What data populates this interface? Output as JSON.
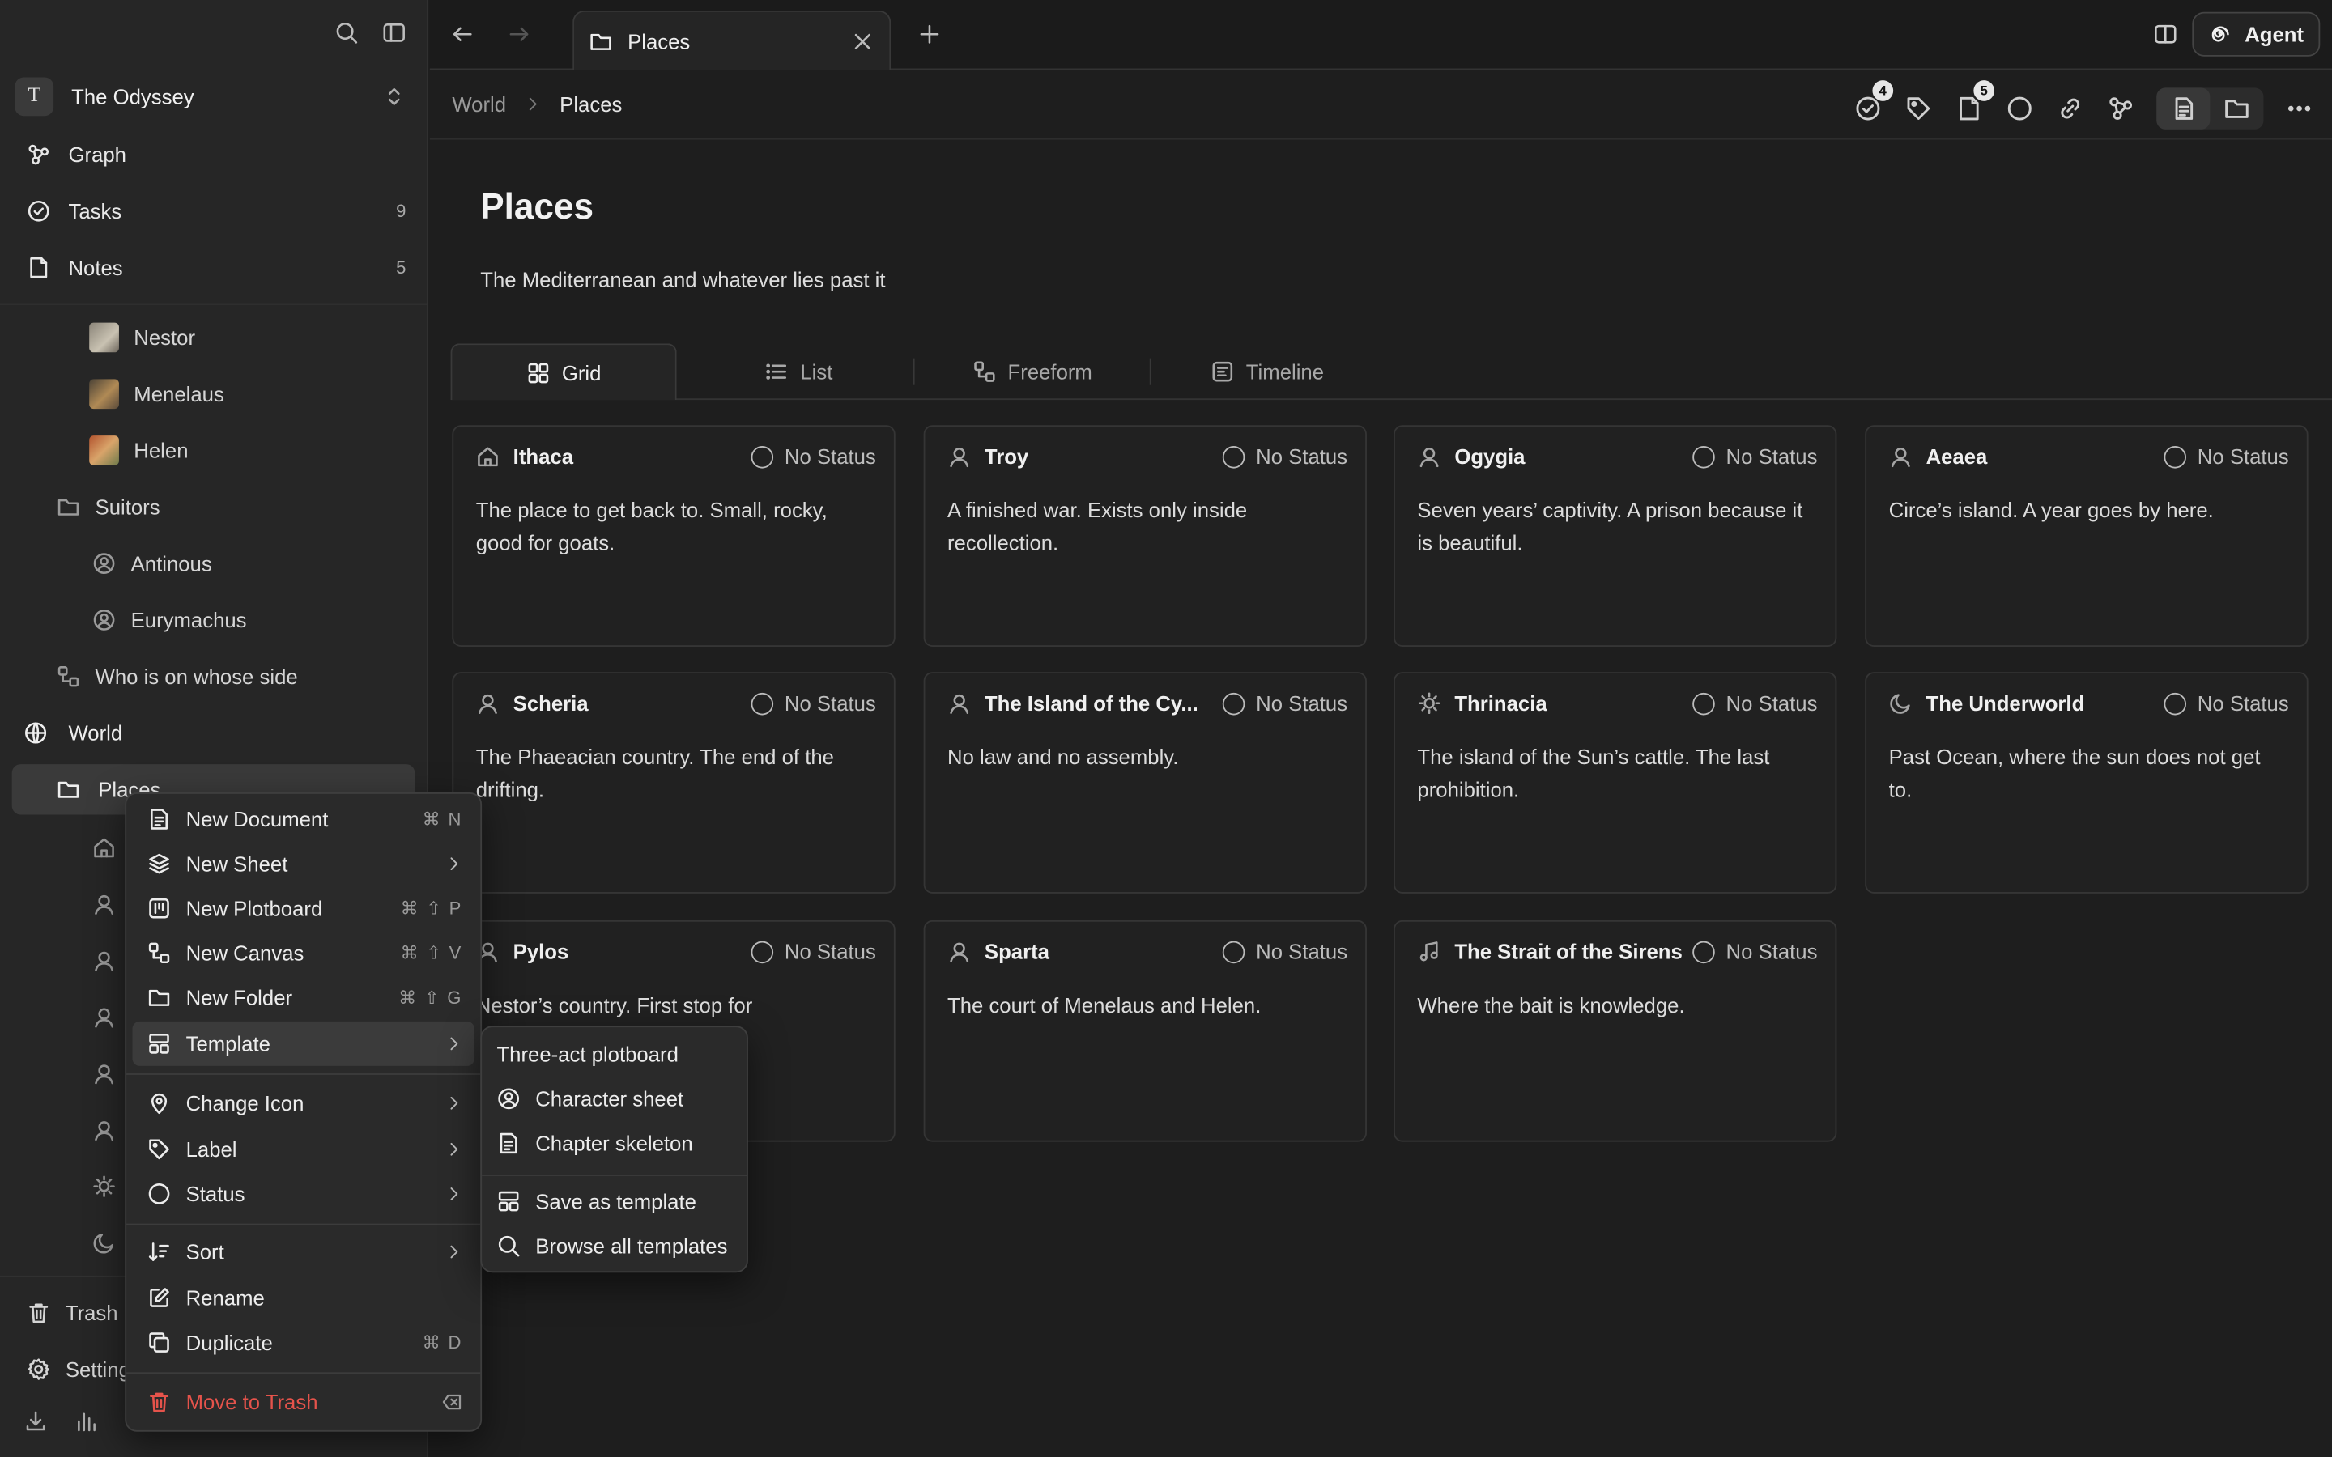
{
  "workspace": {
    "avatar_letter": "T",
    "name": "The Odyssey"
  },
  "nav": [
    {
      "label": "Graph",
      "count": ""
    },
    {
      "label": "Tasks",
      "count": "9"
    },
    {
      "label": "Notes",
      "count": "5"
    }
  ],
  "tree": {
    "nestor": "Nestor",
    "menelaus": "Menelaus",
    "helen": "Helen",
    "suitors": "Suitors",
    "antinous": "Antinous",
    "eurymachus": "Eurymachus",
    "who_side": "Who is on whose side",
    "world": "World",
    "places": "Places"
  },
  "sidebar_bottom": {
    "trash": "Trash",
    "settings": "Settings"
  },
  "tab": {
    "label": "Places"
  },
  "agent_label": "Agent",
  "breadcrumb": {
    "parent": "World",
    "current": "Places"
  },
  "toolbar_badges": {
    "tasks": "4",
    "notes": "5"
  },
  "page": {
    "title": "Places",
    "description": "The Mediterranean and whatever lies past it"
  },
  "view_tabs": [
    "Grid",
    "List",
    "Freeform",
    "Timeline"
  ],
  "status_label": "No Status",
  "cards": [
    {
      "title": "Ithaca",
      "icon": "home-icon",
      "body": "The place to get back to. Small, rocky, good for goats."
    },
    {
      "title": "Troy",
      "icon": "person-icon",
      "body": "A finished war. Exists only inside recollection."
    },
    {
      "title": "Ogygia",
      "icon": "person-icon",
      "body": "Seven years’ captivity. A prison because it is beautiful."
    },
    {
      "title": "Aeaea",
      "icon": "person-icon",
      "body": "Circe’s island. A year goes by here."
    },
    {
      "title": "Scheria",
      "icon": "person-icon",
      "body": "The Phaeacian country. The end of the drifting."
    },
    {
      "title": "The Island of the Cy...",
      "icon": "person-icon",
      "body": "No law and no assembly."
    },
    {
      "title": "Thrinacia",
      "icon": "sun-icon",
      "body": "The island of the Sun’s cattle. The last prohibition."
    },
    {
      "title": "The Underworld",
      "icon": "moon-icon",
      "body": "Past Ocean, where the sun does not get to."
    },
    {
      "title": "Pylos",
      "icon": "person-icon",
      "body": "Nestor’s country. First stop for"
    },
    {
      "title": "Sparta",
      "icon": "person-icon",
      "body": "The court of Menelaus and Helen."
    },
    {
      "title": "The Strait of the Sirens",
      "icon": "music-icon",
      "body": "Where the bait is knowledge."
    }
  ],
  "context_menu": {
    "new_document": {
      "label": "New Document",
      "shortcut": "⌘ N"
    },
    "new_sheet": {
      "label": "New Sheet"
    },
    "new_plotboard": {
      "label": "New Plotboard",
      "shortcut": "⌘ ⇧ P"
    },
    "new_canvas": {
      "label": "New Canvas",
      "shortcut": "⌘ ⇧ V"
    },
    "new_folder": {
      "label": "New Folder",
      "shortcut": "⌘ ⇧ G"
    },
    "template": {
      "label": "Template"
    },
    "change_icon": {
      "label": "Change Icon"
    },
    "label": {
      "label": "Label"
    },
    "status": {
      "label": "Status"
    },
    "sort": {
      "label": "Sort"
    },
    "rename": {
      "label": "Rename"
    },
    "duplicate": {
      "label": "Duplicate",
      "shortcut": "⌘ D"
    },
    "move_to_trash": {
      "label": "Move to Trash"
    }
  },
  "template_submenu": {
    "three_act": "Three-act plotboard",
    "character_sheet": "Character sheet",
    "chapter_skeleton": "Chapter skeleton",
    "save_as_template": "Save as template",
    "browse_all": "Browse all templates"
  },
  "colors": {
    "danger": "#e5534b",
    "background": "#1e1e1e",
    "sidebar": "#262626"
  }
}
